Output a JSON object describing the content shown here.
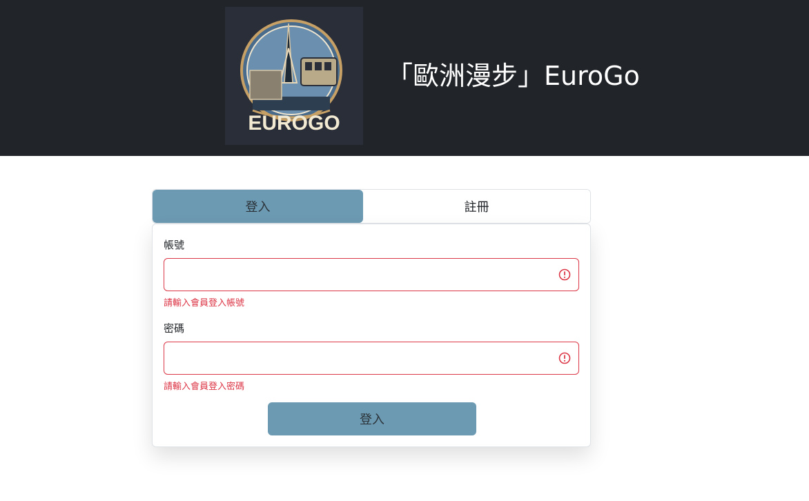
{
  "header": {
    "logo_text": "EUROGO",
    "site_title": "「歐洲漫步」EuroGo"
  },
  "tabs": [
    {
      "label": "登入",
      "active": true
    },
    {
      "label": "註冊",
      "active": false
    }
  ],
  "form": {
    "account": {
      "label": "帳號",
      "value": "",
      "error": "請輸入會員登入帳號"
    },
    "password": {
      "label": "密碼",
      "value": "",
      "error": "請輸入會員登入密碼"
    },
    "submit_label": "登入"
  },
  "colors": {
    "header_bg": "#212529",
    "accent": "#6c9ab2",
    "error": "#dc3545"
  }
}
